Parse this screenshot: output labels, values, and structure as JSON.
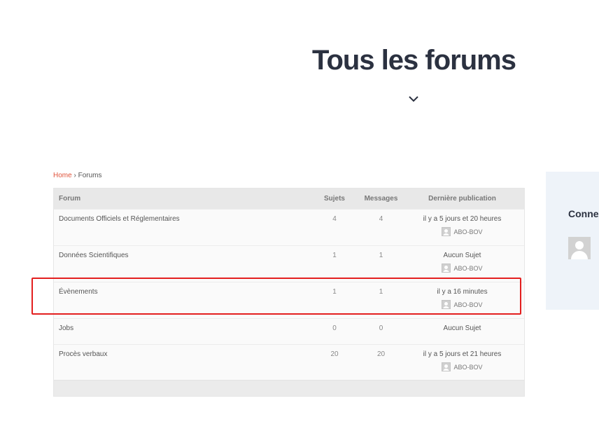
{
  "page": {
    "title": "Tous les forums"
  },
  "breadcrumb": {
    "home": "Home",
    "separator": "›",
    "current": "Forums"
  },
  "table": {
    "headers": {
      "forum": "Forum",
      "topics": "Sujets",
      "messages": "Messages",
      "last": "Dernière publication"
    },
    "rows": [
      {
        "name": "Documents Officiels et Réglementaires",
        "topics": "4",
        "messages": "4",
        "last": "il y a 5 jours et 20 heures",
        "author": "ABO-BOV"
      },
      {
        "name": "Données Scientifiques",
        "topics": "1",
        "messages": "1",
        "last": "Aucun Sujet",
        "author": "ABO-BOV"
      },
      {
        "name": "Évènements",
        "topics": "1",
        "messages": "1",
        "last": "il y a 16 minutes",
        "author": "ABO-BOV"
      },
      {
        "name": "Jobs",
        "topics": "0",
        "messages": "0",
        "last": "Aucun Sujet",
        "author": ""
      },
      {
        "name": "Procès verbaux",
        "topics": "20",
        "messages": "20",
        "last": "il y a 5 jours et 21 heures",
        "author": "ABO-BOV"
      }
    ]
  },
  "sidebar": {
    "title": "Connexion"
  },
  "colors": {
    "title": "#2b3140",
    "link": "#e0533b",
    "highlight": "#e31f1f",
    "sidebar_bg": "#eef3f9"
  }
}
